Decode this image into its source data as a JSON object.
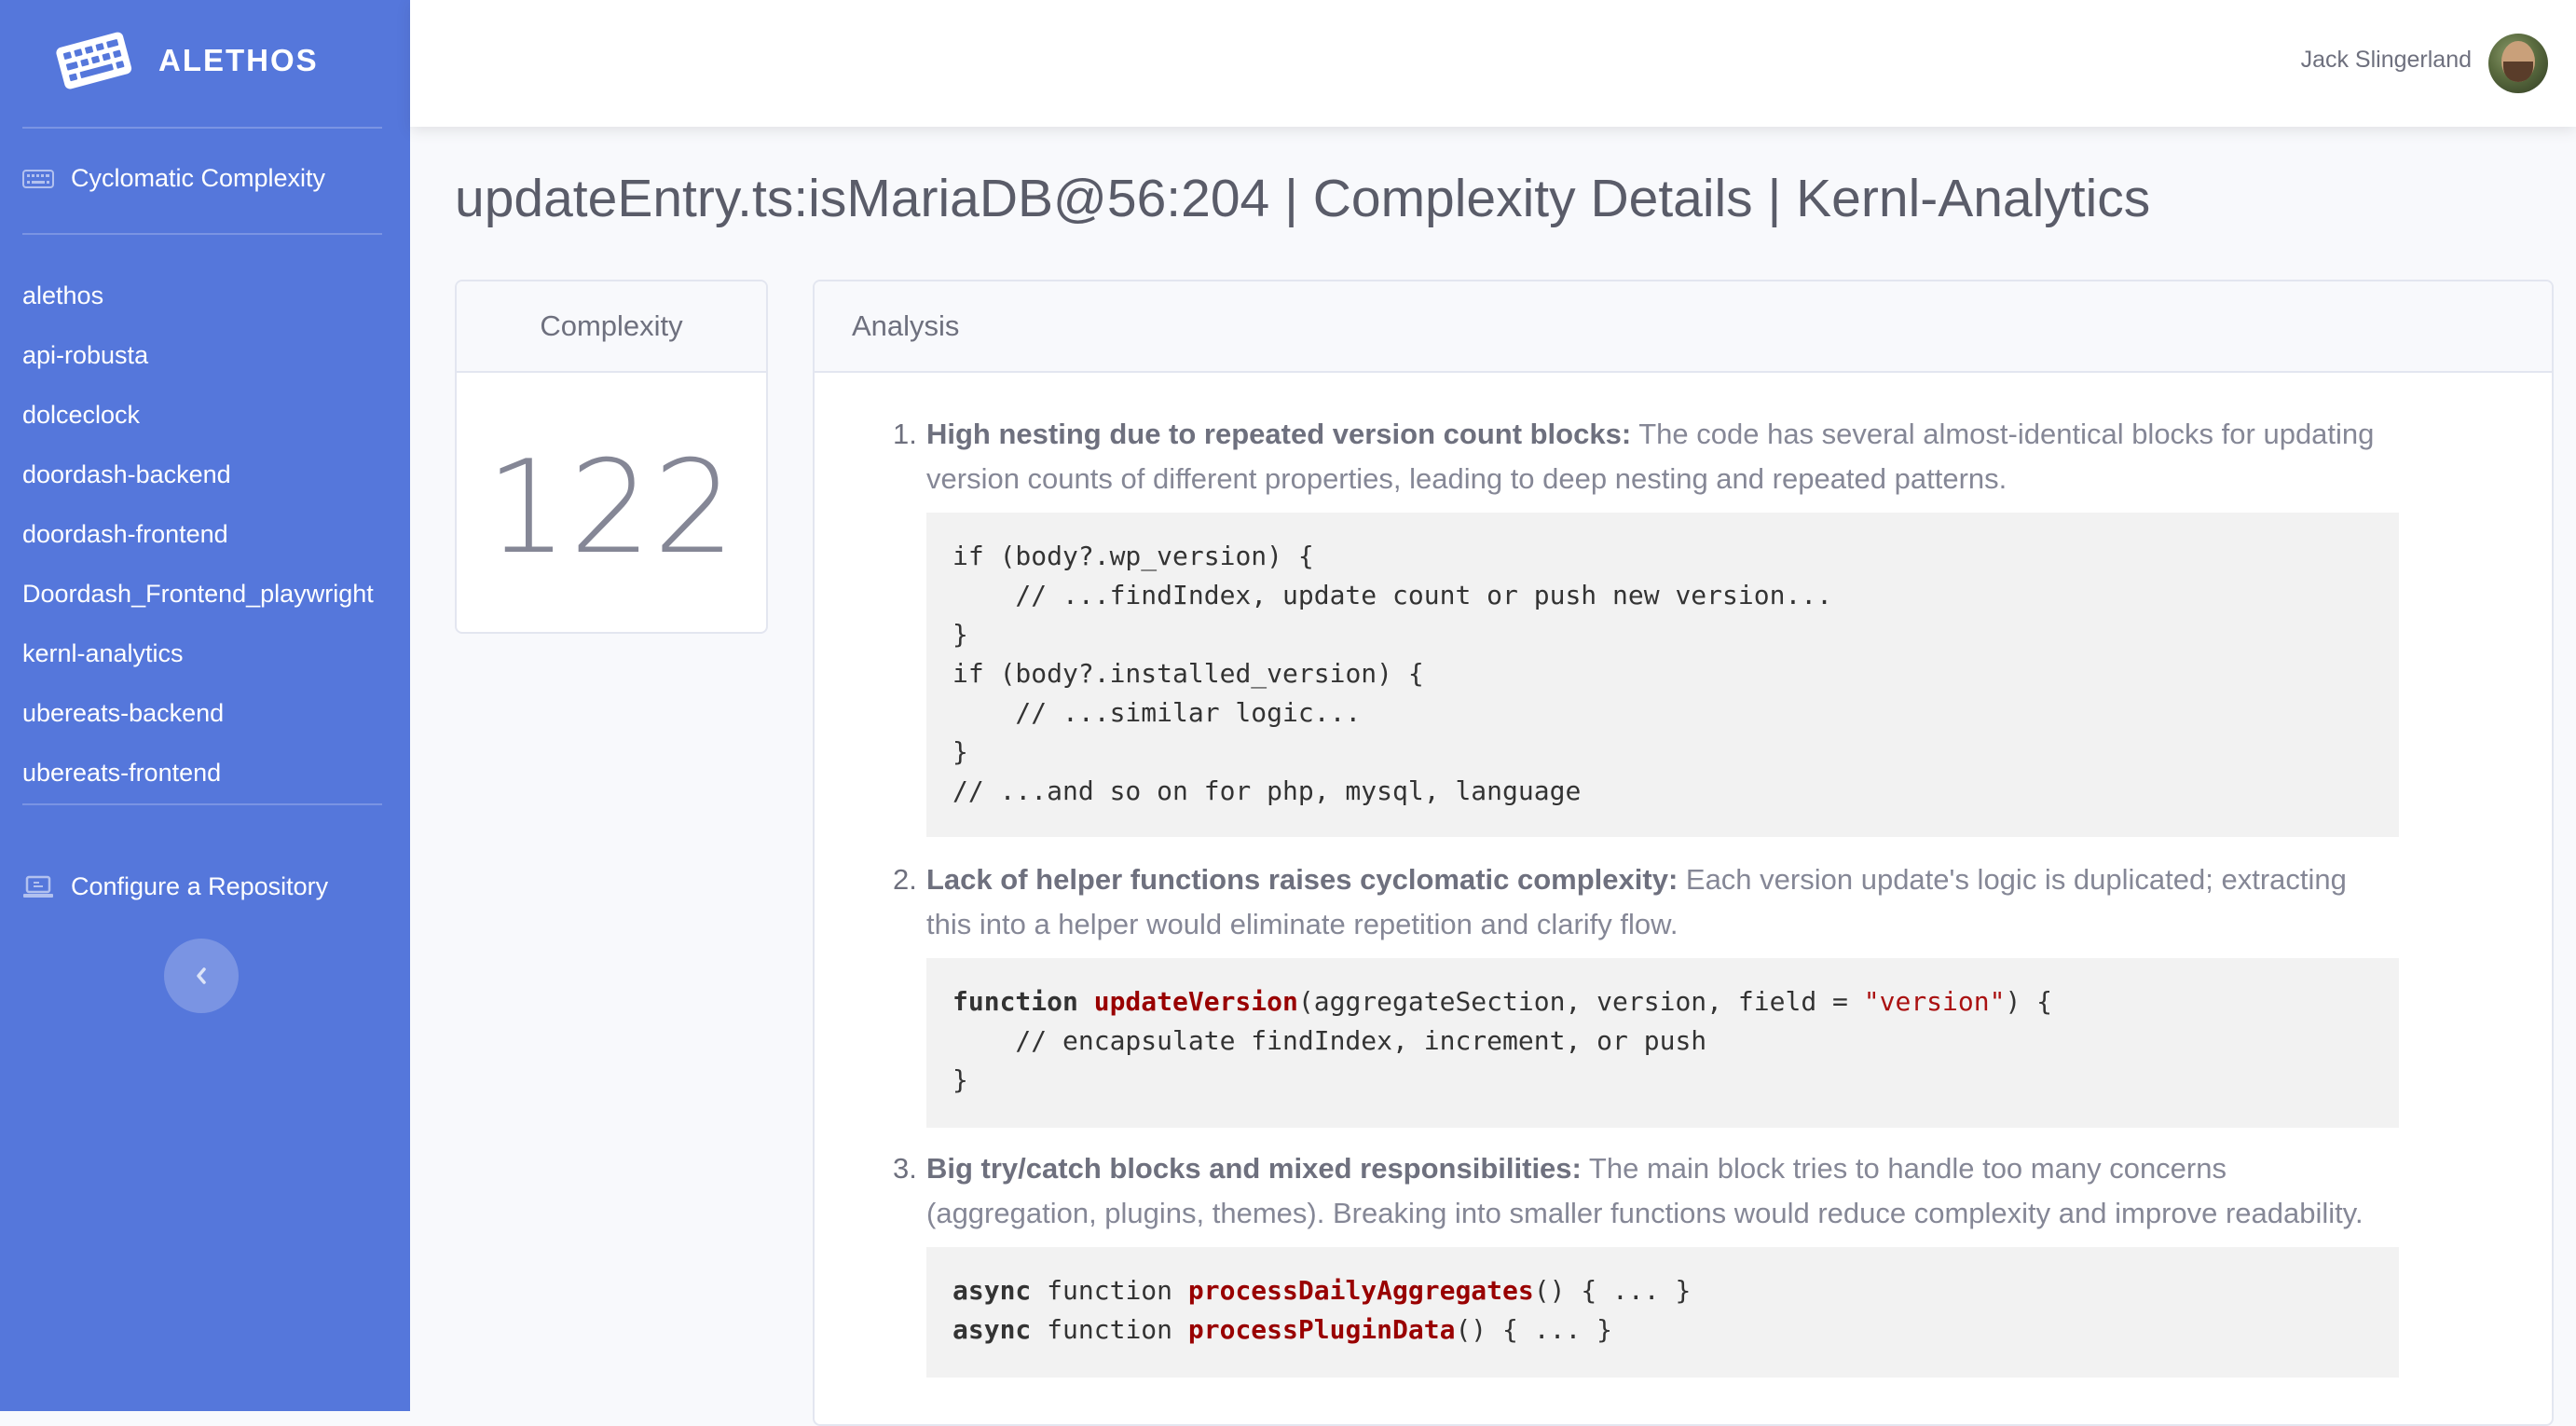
{
  "app": {
    "brand": "ALETHOS"
  },
  "sidebar": {
    "primary_item": "Cyclomatic Complexity",
    "repos": [
      "alethos",
      "api-robusta",
      "dolceclock",
      "doordash-backend",
      "doordash-frontend",
      "Doordash_Frontend_playwright",
      "kernl-analytics",
      "ubereats-backend",
      "ubereats-frontend"
    ],
    "configure_item": "Configure a Repository"
  },
  "topbar": {
    "user_name": "Jack Slingerland"
  },
  "page": {
    "title": "updateEntry.ts:isMariaDB@56:204 | Complexity Details | Kernl-Analytics"
  },
  "complexity": {
    "header": "Complexity",
    "value": "122"
  },
  "analysis": {
    "header": "Analysis",
    "items": [
      {
        "num": "1.",
        "title": "High nesting due to repeated version count blocks:",
        "text": " The code has several almost-identical blocks for updating version counts of different properties, leading to deep nesting and repeated patterns.",
        "code": [
          "if (body?.wp_version) {",
          "    // ...findIndex, update count or push new version...",
          "}",
          "if (body?.installed_version) {",
          "    // ...similar logic...",
          "}",
          "// ...and so on for php, mysql, language"
        ]
      },
      {
        "num": "2.",
        "title": "Lack of helper functions raises cyclomatic complexity:",
        "text": " Each version update's logic is duplicated; extracting this into a helper would eliminate repetition and clarify flow.",
        "code": [
          "function updateVersion(aggregateSection, version, field = \"version\") {",
          "    // encapsulate findIndex, increment, or push",
          "}"
        ]
      },
      {
        "num": "3.",
        "title": "Big try/catch blocks and mixed responsibilities:",
        "text": " The main block tries to handle too many concerns (aggregation, plugins, themes). Breaking into smaller functions would reduce complexity and improve readability.",
        "code": [
          "async function processDailyAggregates() { ... }",
          "async function processPluginData() { ... }"
        ]
      }
    ]
  },
  "colors": {
    "sidebar_bg": "#5577db",
    "page_bg": "#f8f9fc",
    "code_bg": "#f2f2f2",
    "code_function_name": "#990000"
  },
  "icons": {
    "brand": "keyboard-icon",
    "primary_item": "keyboard-icon",
    "configure_item": "laptop-icon",
    "collapse": "chevron-left-icon"
  }
}
